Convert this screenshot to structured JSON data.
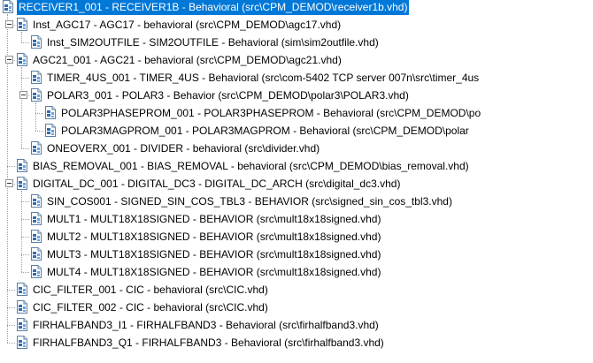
{
  "tree": {
    "nodes": [
      {
        "label": "RECEIVER1_001 - RECEIVER1B - Behavioral (src\\CPM_DEMOD\\receiver1b.vhd)",
        "selected": true
      },
      {
        "label": "Inst_AGC17 - AGC17 - behavioral (src\\CPM_DEMOD\\agc17.vhd)",
        "expanded": true
      },
      {
        "label": "Inst_SIM2OUTFILE - SIM2OUTFILE - Behavioral (sim\\sim2outfile.vhd)"
      },
      {
        "label": "AGC21_001 - AGC21 - behavioral (src\\CPM_DEMOD\\agc21.vhd)",
        "expanded": true
      },
      {
        "label": "TIMER_4US_001 - TIMER_4US - Behavioral (src\\com-5402 TCP server 007n\\src\\timer_4us"
      },
      {
        "label": "POLAR3_001 - POLAR3 - Behavior (src\\CPM_DEMOD\\polar3\\POLAR3.vhd)",
        "expanded": true
      },
      {
        "label": "POLAR3PHASEPROM_001 - POLAR3PHASEPROM - Behavioral (src\\CPM_DEMOD\\po"
      },
      {
        "label": "POLAR3MAGPROM_001 - POLAR3MAGPROM - Behavioral (src\\CPM_DEMOD\\polar"
      },
      {
        "label": "ONEOVERX_001 - DIVIDER - behavioral (src\\divider.vhd)"
      },
      {
        "label": "BIAS_REMOVAL_001 - BIAS_REMOVAL - behavioral (src\\CPM_DEMOD\\bias_removal.vhd)"
      },
      {
        "label": "DIGITAL_DC_001 - DIGITAL_DC3 - DIGITAL_DC_ARCH (src\\digital_dc3.vhd)",
        "expanded": true
      },
      {
        "label": "SIN_COS001 - SIGNED_SIN_COS_TBL3 - BEHAVIOR (src\\signed_sin_cos_tbl3.vhd)"
      },
      {
        "label": "MULT1 - MULT18X18SIGNED - BEHAVIOR (src\\mult18x18signed.vhd)"
      },
      {
        "label": "MULT2 - MULT18X18SIGNED - BEHAVIOR (src\\mult18x18signed.vhd)"
      },
      {
        "label": "MULT3 - MULT18X18SIGNED - BEHAVIOR (src\\mult18x18signed.vhd)"
      },
      {
        "label": "MULT4 - MULT18X18SIGNED - BEHAVIOR (src\\mult18x18signed.vhd)"
      },
      {
        "label": "CIC_FILTER_001 - CIC - behavioral (src\\CIC.vhd)"
      },
      {
        "label": "CIC_FILTER_002 - CIC - behavioral (src\\CIC.vhd)"
      },
      {
        "label": "FIRHALFBAND3_I1 - FIRHALFBAND3 - Behavioral (src\\firhalfband3.vhd)"
      },
      {
        "label": "FIRHALFBAND3_Q1 - FIRHALFBAND3 - Behavioral (src\\firhalfband3.vhd)"
      }
    ]
  },
  "icons": {
    "file": "vhdl-file-icon",
    "expander": "collapse-minus-icon"
  },
  "colors": {
    "selection": "#0078d7",
    "selection_text": "#ffffff",
    "tree_lines": "#a0a0a0"
  }
}
